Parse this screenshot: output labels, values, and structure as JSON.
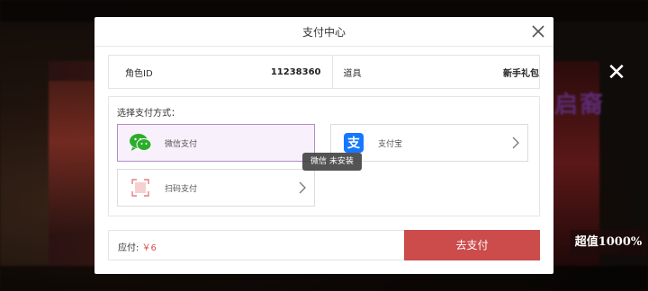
{
  "background": {
    "promo_text": "超值1000%",
    "side_text": "启裔"
  },
  "dialog": {
    "title": "支付中心",
    "close_icon": "close-icon"
  },
  "info": {
    "role_label": "角色ID",
    "role_value": "11238360",
    "item_label": "道具",
    "item_value": "新手礼包"
  },
  "payment": {
    "prompt": "选择支付方式：",
    "options": [
      {
        "label": "微信支付",
        "icon": "wechat-icon",
        "selected": true
      },
      {
        "label": "支付宝",
        "icon": "alipay-icon",
        "selected": false
      },
      {
        "label": "扫码支付",
        "icon": "qr-scan-icon",
        "selected": false
      }
    ],
    "tooltip": "微信 未安装"
  },
  "footer": {
    "amount_label": "应付: ",
    "amount_value": "￥6",
    "pay_button": "去支付"
  },
  "colors": {
    "pay_button": "#cc4b4b",
    "selected_border": "#b48cc8",
    "price": "#d9534f",
    "wechat_green": "#2aae2a",
    "alipay_blue": "#1678ff"
  }
}
